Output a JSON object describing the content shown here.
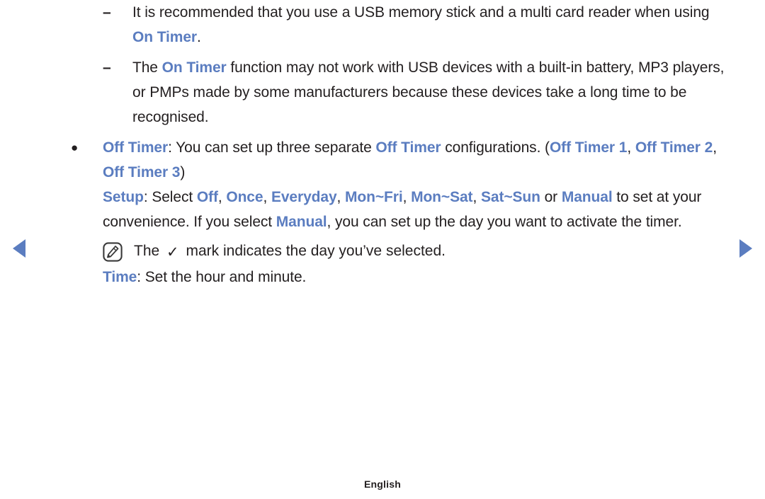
{
  "accent_color": "#5b7dc0",
  "text_color": "#231f20",
  "nav": {
    "prev_label": "previous page",
    "next_label": "next page",
    "prev_icon": "triangle-left-icon",
    "next_icon": "triangle-right-icon"
  },
  "content": {
    "items": [
      {
        "level": 2,
        "marker": "–",
        "segments": [
          {
            "text": "It is recommended that you use a USB memory stick and a multi card reader when using ",
            "style": "plain"
          },
          {
            "text": "On Timer",
            "style": "highlight"
          },
          {
            "text": ".",
            "style": "plain"
          }
        ]
      },
      {
        "level": 2,
        "marker": "–",
        "segments": [
          {
            "text": "The ",
            "style": "plain"
          },
          {
            "text": "On Timer",
            "style": "highlight"
          },
          {
            "text": " function may not work with USB devices with a built-in battery, MP3 players, or PMPs made by some manufacturers because these devices take a long time to be recognised.",
            "style": "plain"
          }
        ]
      },
      {
        "level": 1,
        "marker": "●",
        "segments": [
          {
            "text": "Off Timer",
            "style": "highlight"
          },
          {
            "text": ": You can set up three separate ",
            "style": "plain"
          },
          {
            "text": "Off Timer",
            "style": "highlight"
          },
          {
            "text": " configurations. (",
            "style": "plain"
          },
          {
            "text": "Off Timer 1",
            "style": "highlight"
          },
          {
            "text": ", ",
            "style": "plain"
          },
          {
            "text": "Off Timer 2",
            "style": "highlight"
          },
          {
            "text": ", ",
            "style": "plain"
          },
          {
            "text": "Off Timer 3",
            "style": "highlight"
          },
          {
            "text": ")",
            "style": "plain"
          }
        ]
      },
      {
        "level": 1,
        "marker": "",
        "segments": [
          {
            "text": "Setup",
            "style": "highlight"
          },
          {
            "text": ": Select ",
            "style": "plain"
          },
          {
            "text": "Off",
            "style": "highlight"
          },
          {
            "text": ", ",
            "style": "plain"
          },
          {
            "text": "Once",
            "style": "highlight"
          },
          {
            "text": ", ",
            "style": "plain"
          },
          {
            "text": "Everyday",
            "style": "highlight"
          },
          {
            "text": ", ",
            "style": "plain"
          },
          {
            "text": "Mon~Fri",
            "style": "highlight"
          },
          {
            "text": ", ",
            "style": "plain"
          },
          {
            "text": "Mon~Sat",
            "style": "highlight"
          },
          {
            "text": ", ",
            "style": "plain"
          },
          {
            "text": "Sat~Sun",
            "style": "highlight"
          },
          {
            "text": " or ",
            "style": "plain"
          },
          {
            "text": "Manual",
            "style": "highlight"
          },
          {
            "text": " to set at your convenience. If you select ",
            "style": "plain"
          },
          {
            "text": "Manual",
            "style": "highlight"
          },
          {
            "text": ", you can set up the day you want to activate the timer.",
            "style": "plain"
          }
        ]
      }
    ],
    "note": {
      "icon": "note-pencil-icon",
      "segments": [
        {
          "text": "The ",
          "style": "plain"
        },
        {
          "text": "✓",
          "style": "check"
        },
        {
          "text": " mark indicates the day you’ve selected.",
          "style": "plain"
        }
      ]
    },
    "note_follow": {
      "segments": [
        {
          "text": "Time",
          "style": "highlight"
        },
        {
          "text": ": Set the hour and minute.",
          "style": "plain"
        }
      ]
    }
  },
  "footer": {
    "language": "English"
  }
}
